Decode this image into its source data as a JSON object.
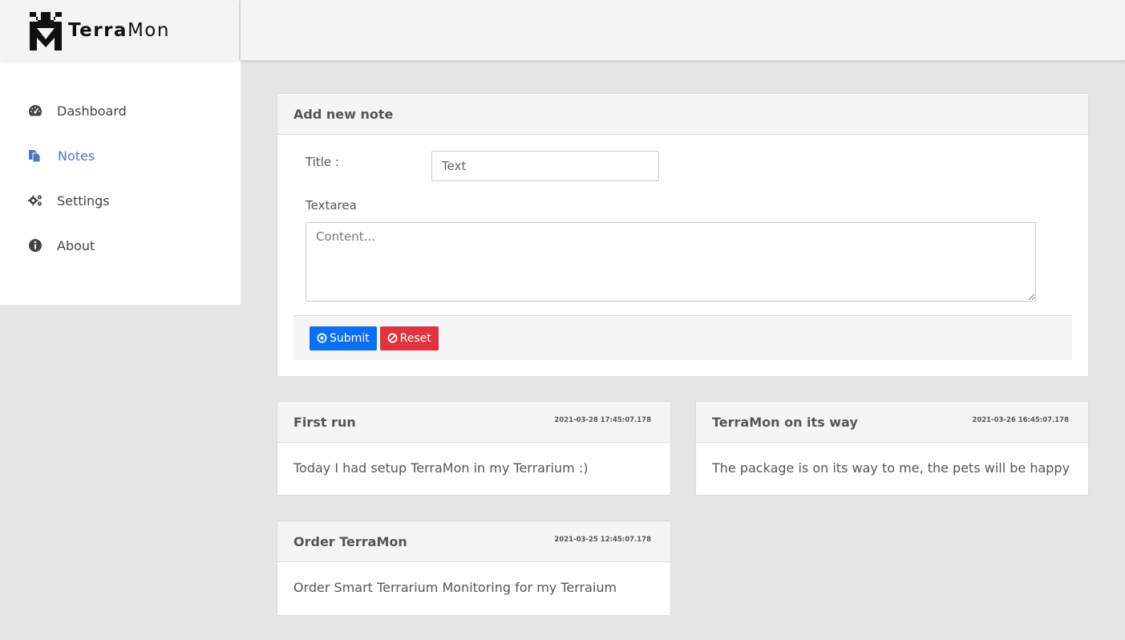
{
  "brand": {
    "name_bold": "Terra",
    "name_rest": "Mon"
  },
  "sidebar": {
    "items": [
      {
        "label": "Dashboard",
        "icon": "dashboard-icon",
        "active": false
      },
      {
        "label": "Notes",
        "icon": "notes-icon",
        "active": true
      },
      {
        "label": "Settings",
        "icon": "settings-icon",
        "active": false
      },
      {
        "label": "About",
        "icon": "info-icon",
        "active": false
      }
    ]
  },
  "form": {
    "header": "Add new note",
    "title_label": "Title :",
    "title_placeholder": "Text",
    "textarea_label": "Textarea",
    "textarea_placeholder": "Content...",
    "submit_label": "Submit",
    "reset_label": "Reset"
  },
  "notes": [
    {
      "title": "First run",
      "timestamp": "2021-03-28 17:45:07.178",
      "body": "Today I had setup TerraMon in my Terrarium :)"
    },
    {
      "title": "TerraMon on its way",
      "timestamp": "2021-03-26 16:45:07.178",
      "body": "The package is on its way to me, the pets will be happy"
    },
    {
      "title": "Order TerraMon",
      "timestamp": "2021-03-25 12:45:07.178",
      "body": "Order Smart Terrarium Monitoring for my Terraium"
    }
  ],
  "colors": {
    "accent": "#4a78c9",
    "submit": "#0a6ff0",
    "reset": "#e03240",
    "background": "#e5e5e5"
  }
}
